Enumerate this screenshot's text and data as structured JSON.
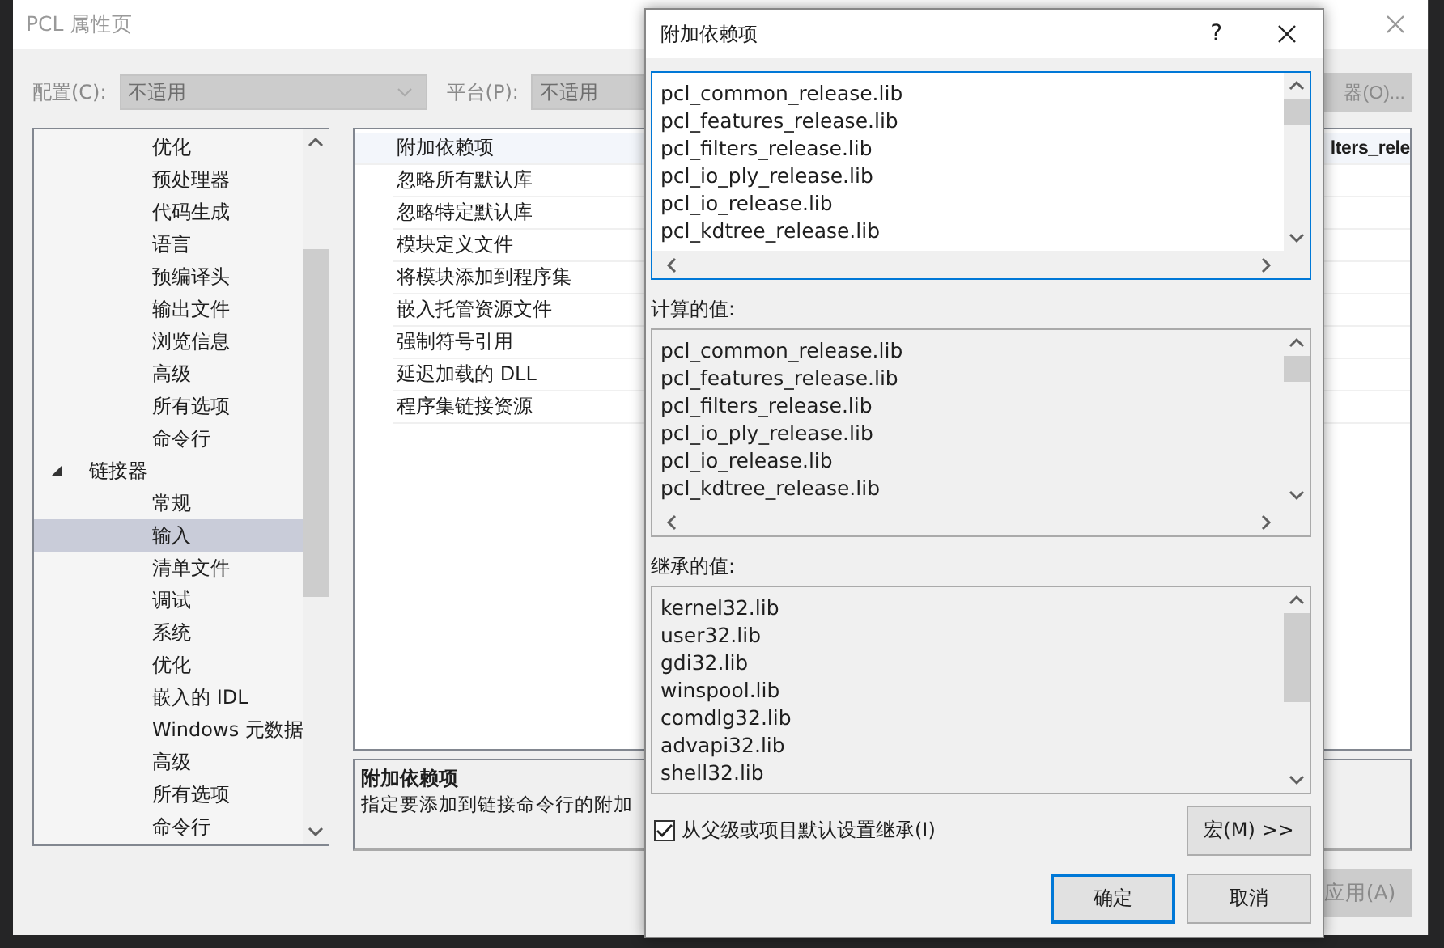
{
  "window": {
    "title": "PCL 属性页"
  },
  "config": {
    "label": "配置(C):",
    "value": "不适用",
    "disabled": true
  },
  "platform": {
    "label": "平台(P):",
    "value": "不适用",
    "disabled": true
  },
  "manager_button": {
    "label": "器(O)...",
    "disabled": true
  },
  "tree": {
    "items": [
      {
        "children": [
          {
            "label": "优化",
            "selected": false
          },
          {
            "label": "预处理器",
            "selected": false
          },
          {
            "label": "代码生成",
            "selected": false
          },
          {
            "label": "语言",
            "selected": false
          },
          {
            "label": "预编译头",
            "selected": false
          },
          {
            "label": "输出文件",
            "selected": false
          },
          {
            "label": "浏览信息",
            "selected": false
          },
          {
            "label": "高级",
            "selected": false
          },
          {
            "label": "所有选项",
            "selected": false
          },
          {
            "label": "命令行",
            "selected": false
          }
        ]
      },
      {
        "label": "链接器",
        "selected": false,
        "expanded": true,
        "children": [
          {
            "label": "常规",
            "selected": false
          },
          {
            "label": "输入",
            "selected": true
          },
          {
            "label": "清单文件",
            "selected": false
          },
          {
            "label": "调试",
            "selected": false
          },
          {
            "label": "系统",
            "selected": false
          },
          {
            "label": "优化",
            "selected": false
          },
          {
            "label": "嵌入的 IDL",
            "selected": false
          },
          {
            "label": "Windows 元数据",
            "selected": false
          },
          {
            "label": "高级",
            "selected": false
          },
          {
            "label": "所有选项",
            "selected": false
          },
          {
            "label": "命令行",
            "selected": false
          }
        ]
      }
    ]
  },
  "grid": {
    "rows": [
      {
        "name": "附加依赖项",
        "value": "lters_rele",
        "selected": true
      },
      {
        "name": "忽略所有默认库",
        "selected": false
      },
      {
        "name": "忽略特定默认库",
        "selected": false
      },
      {
        "name": "模块定义文件",
        "selected": false
      },
      {
        "name": "将模块添加到程序集",
        "selected": false
      },
      {
        "name": "嵌入托管资源文件",
        "selected": false
      },
      {
        "name": "强制符号引用",
        "selected": false
      },
      {
        "name": "延迟加载的 DLL",
        "selected": false
      },
      {
        "name": "程序集链接资源",
        "selected": false
      }
    ]
  },
  "description": {
    "title": "附加依赖项",
    "text": "指定要添加到链接命令行的附加"
  },
  "apply_button": {
    "label": "应用(A)",
    "disabled": true
  },
  "dialog": {
    "title": "附加依赖项",
    "help": "?",
    "edit_list": [
      "pcl_common_release.lib",
      "pcl_features_release.lib",
      "pcl_filters_release.lib",
      "pcl_io_ply_release.lib",
      "pcl_io_release.lib",
      "pcl_kdtree_release.lib"
    ],
    "computed_label": "计算的值:",
    "computed_list": [
      "pcl_common_release.lib",
      "pcl_features_release.lib",
      "pcl_filters_release.lib",
      "pcl_io_ply_release.lib",
      "pcl_io_release.lib",
      "pcl_kdtree_release.lib"
    ],
    "inherited_label": "继承的值:",
    "inherited_list": [
      "kernel32.lib",
      "user32.lib",
      "gdi32.lib",
      "winspool.lib",
      "comdlg32.lib",
      "advapi32.lib",
      "shell32.lib"
    ],
    "inherit_checkbox": {
      "label": "从父级或项目默认设置继承(I)",
      "checked": true
    },
    "macro_button": "宏(M) >>",
    "ok_button": "确定",
    "cancel_button": "取消"
  }
}
